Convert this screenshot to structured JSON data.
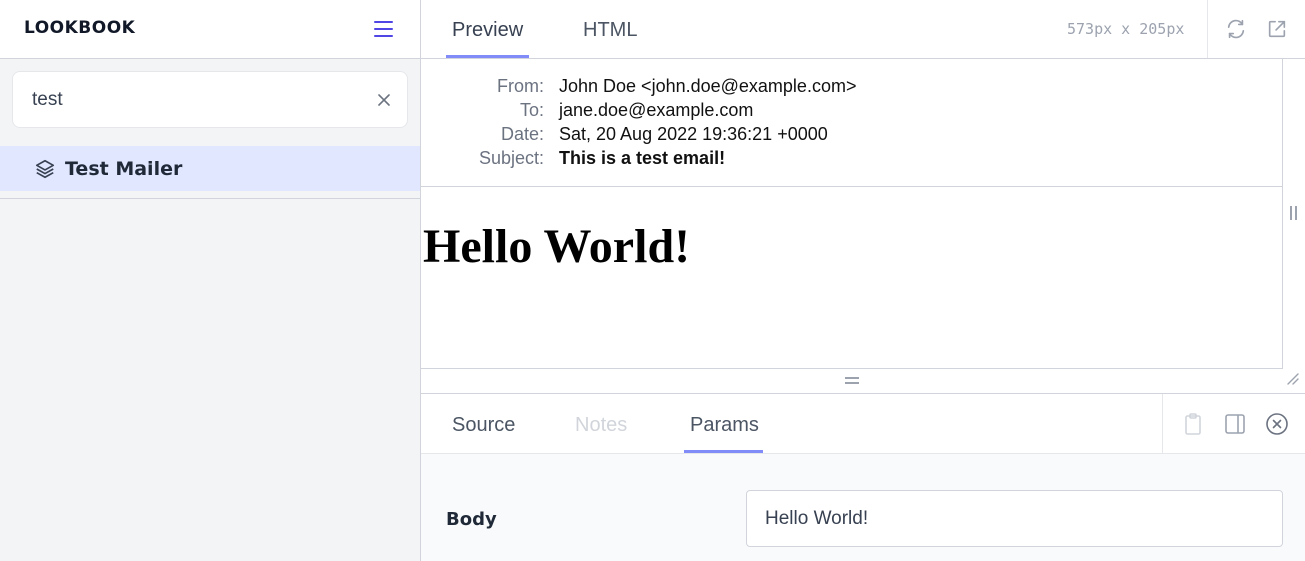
{
  "sidebar": {
    "brand": "LOOKBOOK",
    "search": {
      "value": "test"
    },
    "items": [
      {
        "label": "Test Mailer"
      }
    ]
  },
  "preview_tabs": [
    {
      "label": "Preview",
      "active": true
    },
    {
      "label": "HTML",
      "active": false
    }
  ],
  "dimensions": "573px x 205px",
  "email": {
    "headers": [
      {
        "key": "From:",
        "value": "John Doe <john.doe@example.com>"
      },
      {
        "key": "To:",
        "value": "jane.doe@example.com"
      },
      {
        "key": "Date:",
        "value": "Sat, 20 Aug 2022 19:36:21 +0000"
      },
      {
        "key": "Subject:",
        "value": "This is a test email!"
      }
    ],
    "body_heading": "Hello World!"
  },
  "inspector": {
    "tabs": [
      {
        "label": "Source",
        "state": "normal"
      },
      {
        "label": "Notes",
        "state": "disabled"
      },
      {
        "label": "Params",
        "state": "active"
      }
    ],
    "params": [
      {
        "label": "Body",
        "value": "Hello World!"
      }
    ]
  },
  "colors": {
    "accent": "#818cf8",
    "brand_icon": "#4f46e5",
    "selected_bg": "#e0e7ff",
    "sidebar_bg": "#f3f4f6"
  },
  "icons": [
    "hamburger-menu-icon",
    "close-icon",
    "layers-icon",
    "refresh-icon",
    "external-link-icon",
    "clipboard-icon",
    "split-panel-icon",
    "close-circle-icon"
  ]
}
